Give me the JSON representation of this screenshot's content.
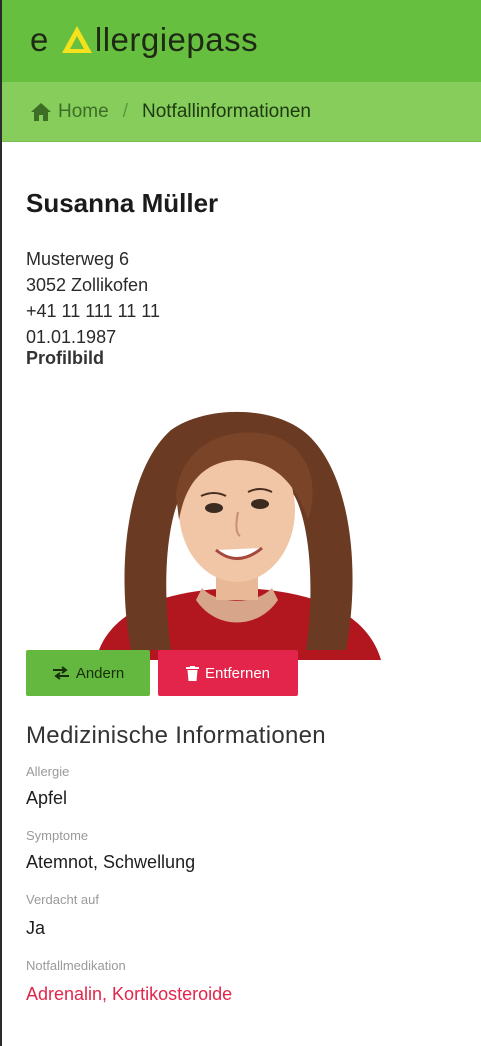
{
  "header": {
    "brand_prefix": "e",
    "brand_suffix": "llergiepass",
    "brand_color": "#67bf40",
    "logo_icon": "warning-triangle-icon"
  },
  "breadcrumb": {
    "home_label": "Home",
    "separator": "/",
    "current_label": "Notfallinformationen"
  },
  "person": {
    "name": "Susanna Müller",
    "street": "Musterweg 6",
    "city": "3052 Zollikofen",
    "phone": "+41 11 111 11 11",
    "birthdate": "01.01.1987",
    "profile_label": "Profilbild"
  },
  "actions": {
    "edit_label": "Andern",
    "edit_icon": "swap-arrows-icon",
    "remove_label": "Entfernen",
    "remove_icon": "trash-icon",
    "remove_color": "#e3254b"
  },
  "medical": {
    "title": "Medizinische Informationen",
    "fields": [
      {
        "label": "Allergie",
        "value": "Apfel"
      },
      {
        "label": "Symptome",
        "value": "Atemnot, Schwellung"
      },
      {
        "label": "Verdacht auf",
        "value": "Ja"
      },
      {
        "label": "Notfallmedikation",
        "value": "Adrenalin, Kortikosteroide"
      }
    ]
  }
}
